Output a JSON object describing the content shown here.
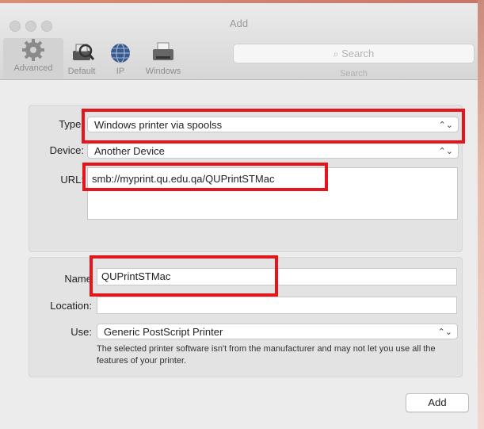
{
  "window": {
    "title": "Add"
  },
  "toolbar": {
    "items": [
      {
        "label": "Advanced",
        "icon": "gear-icon"
      },
      {
        "label": "Default",
        "icon": "default-printer-icon"
      },
      {
        "label": "IP",
        "icon": "globe-icon"
      },
      {
        "label": "Windows",
        "icon": "windows-printer-icon"
      }
    ],
    "search_placeholder": "Search",
    "search_caption": "Search"
  },
  "connection": {
    "type_label": "Type:",
    "type_value": "Windows printer via spoolss",
    "device_label": "Device:",
    "device_value": "Another Device",
    "url_label": "URL:",
    "url_value": "smb://myprint.qu.edu.qa/QUPrintSTMac"
  },
  "printer": {
    "name_label": "Name",
    "name_value": "QUPrintSTMac",
    "location_label": "Location:",
    "location_value": "",
    "use_label": "Use:",
    "use_value": "Generic PostScript Printer",
    "hint": "The selected printer software isn't from the manufacturer and may not let you use all the features of your printer."
  },
  "footer": {
    "add_label": "Add"
  },
  "colors": {
    "highlight_box": "#e5151c"
  }
}
